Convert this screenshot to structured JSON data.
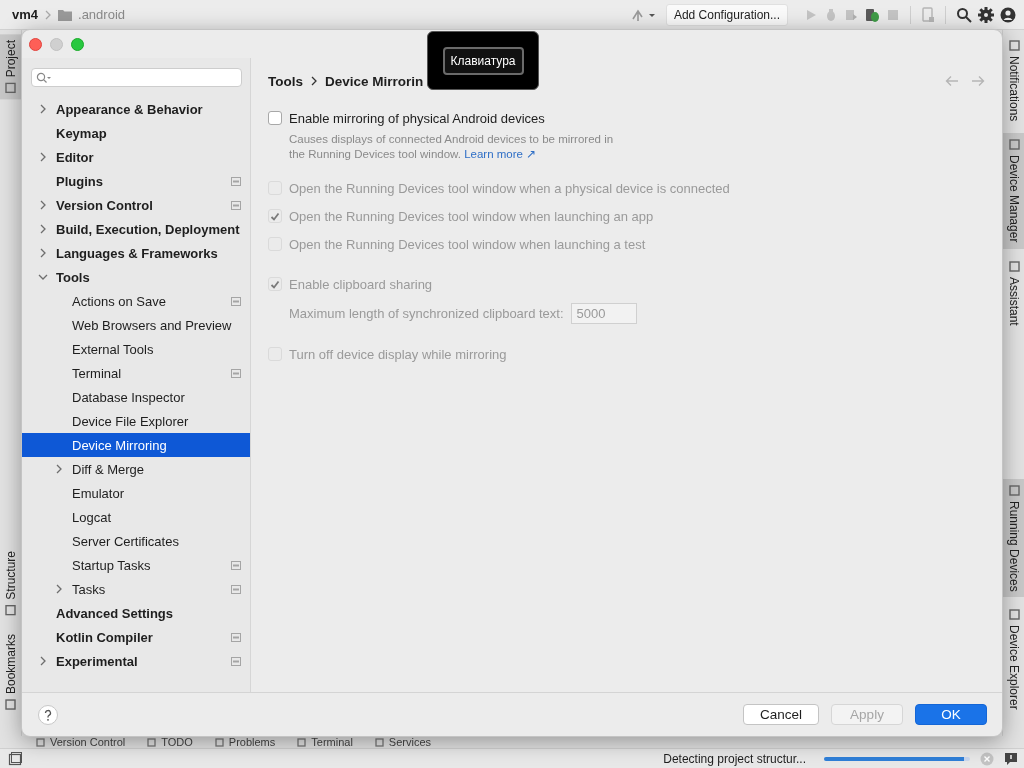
{
  "ide": {
    "project": "vm4",
    "path": ".android",
    "run_config": "Add Configuration...",
    "left_strip": {
      "top": [
        {
          "label": "Project",
          "selected": true
        }
      ],
      "bottom": [
        {
          "label": "Structure",
          "selected": false
        },
        {
          "label": "Bookmarks",
          "selected": false
        }
      ]
    },
    "right_strip": {
      "top": [
        {
          "label": "Notifications",
          "selected": false
        },
        {
          "label": "Device Manager",
          "selected": true
        },
        {
          "label": "Assistant",
          "selected": false
        }
      ],
      "bottom": [
        {
          "label": "Running Devices",
          "selected": true
        },
        {
          "label": "Device Explorer",
          "selected": false
        }
      ]
    },
    "bottom_tools": [
      {
        "label": "Version Control"
      },
      {
        "label": "TODO"
      },
      {
        "label": "Problems"
      },
      {
        "label": "Terminal"
      },
      {
        "label": "Services"
      }
    ],
    "status": {
      "text": "Detecting project structur...",
      "progress": {
        "level": 0.96
      }
    }
  },
  "dialog": {
    "window_buttons": [
      {
        "kind": "close",
        "disabled": false
      },
      {
        "kind": "minimize",
        "disabled": true
      },
      {
        "kind": "zoom",
        "disabled": false
      }
    ],
    "tree": [
      {
        "label": "Appearance & Behavior",
        "kind": "group",
        "expanded": false,
        "project_level": false,
        "selected": false
      },
      {
        "label": "Keymap",
        "kind": "page",
        "project_level": false,
        "selected": false
      },
      {
        "label": "Editor",
        "kind": "group",
        "expanded": false,
        "project_level": false,
        "selected": false
      },
      {
        "label": "Plugins",
        "kind": "page",
        "project_level": true,
        "selected": false
      },
      {
        "label": "Version Control",
        "kind": "group",
        "expanded": false,
        "project_level": true,
        "selected": false
      },
      {
        "label": "Build, Execution, Deployment",
        "kind": "group",
        "expanded": false,
        "project_level": false,
        "selected": false
      },
      {
        "label": "Languages & Frameworks",
        "kind": "group",
        "expanded": false,
        "project_level": false,
        "selected": false
      },
      {
        "label": "Tools",
        "kind": "group",
        "expanded": true,
        "project_level": false,
        "selected": false,
        "children": [
          {
            "label": "Actions on Save",
            "kind": "page",
            "project_level": true,
            "selected": false
          },
          {
            "label": "Web Browsers and Preview",
            "kind": "page",
            "project_level": false,
            "selected": false
          },
          {
            "label": "External Tools",
            "kind": "page",
            "project_level": false,
            "selected": false
          },
          {
            "label": "Terminal",
            "kind": "page",
            "project_level": true,
            "selected": false
          },
          {
            "label": "Database Inspector",
            "kind": "page",
            "project_level": false,
            "selected": false
          },
          {
            "label": "Device File Explorer",
            "kind": "page",
            "project_level": false,
            "selected": false
          },
          {
            "label": "Device Mirroring",
            "kind": "page",
            "project_level": false,
            "selected": true
          },
          {
            "label": "Diff & Merge",
            "kind": "group",
            "expanded": false,
            "project_level": false,
            "selected": false
          },
          {
            "label": "Emulator",
            "kind": "page",
            "project_level": false,
            "selected": false
          },
          {
            "label": "Logcat",
            "kind": "page",
            "project_level": false,
            "selected": false
          },
          {
            "label": "Server Certificates",
            "kind": "page",
            "project_level": false,
            "selected": false
          },
          {
            "label": "Startup Tasks",
            "kind": "page",
            "project_level": true,
            "selected": false
          },
          {
            "label": "Tasks",
            "kind": "group",
            "expanded": false,
            "project_level": true,
            "selected": false
          }
        ]
      },
      {
        "label": "Advanced Settings",
        "kind": "page",
        "project_level": false,
        "selected": false
      },
      {
        "label": "Kotlin Compiler",
        "kind": "page",
        "project_level": true,
        "selected": false
      },
      {
        "label": "Experimental",
        "kind": "group",
        "expanded": false,
        "project_level": true,
        "selected": false
      }
    ],
    "breadcrumb": [
      "Tools",
      "Device Mirrorin"
    ],
    "sections": [
      [
        {
          "kind": "checkbox",
          "label": "Enable mirroring of physical Android devices",
          "checked": false,
          "disabled": false,
          "description": "Causes displays of connected Android devices to be mirrored in the Running Devices tool window.",
          "link": "Learn more ↗"
        }
      ],
      [
        {
          "kind": "checkbox",
          "label": "Open the Running Devices tool window when a physical device is connected",
          "checked": false,
          "disabled": true
        },
        {
          "kind": "checkbox",
          "label": "Open the Running Devices tool window when launching an app",
          "checked": true,
          "disabled": true
        },
        {
          "kind": "checkbox",
          "label": "Open the Running Devices tool window when launching a test",
          "checked": false,
          "disabled": true
        }
      ],
      [
        {
          "kind": "checkbox",
          "label": "Enable clipboard sharing",
          "checked": true,
          "disabled": true
        },
        {
          "kind": "field",
          "label": "Maximum length of synchronized clipboard text:",
          "value": "5000",
          "disabled": true
        }
      ],
      [
        {
          "kind": "checkbox",
          "label": "Turn off device display while mirroring",
          "checked": false,
          "disabled": true
        }
      ]
    ],
    "buttons": [
      {
        "label": "Cancel",
        "kind": "secondary",
        "disabled": false
      },
      {
        "label": "Apply",
        "kind": "secondary",
        "disabled": true
      },
      {
        "label": "OK",
        "kind": "primary",
        "disabled": false
      }
    ]
  },
  "tooltip": {
    "text": "Клавиатура"
  }
}
